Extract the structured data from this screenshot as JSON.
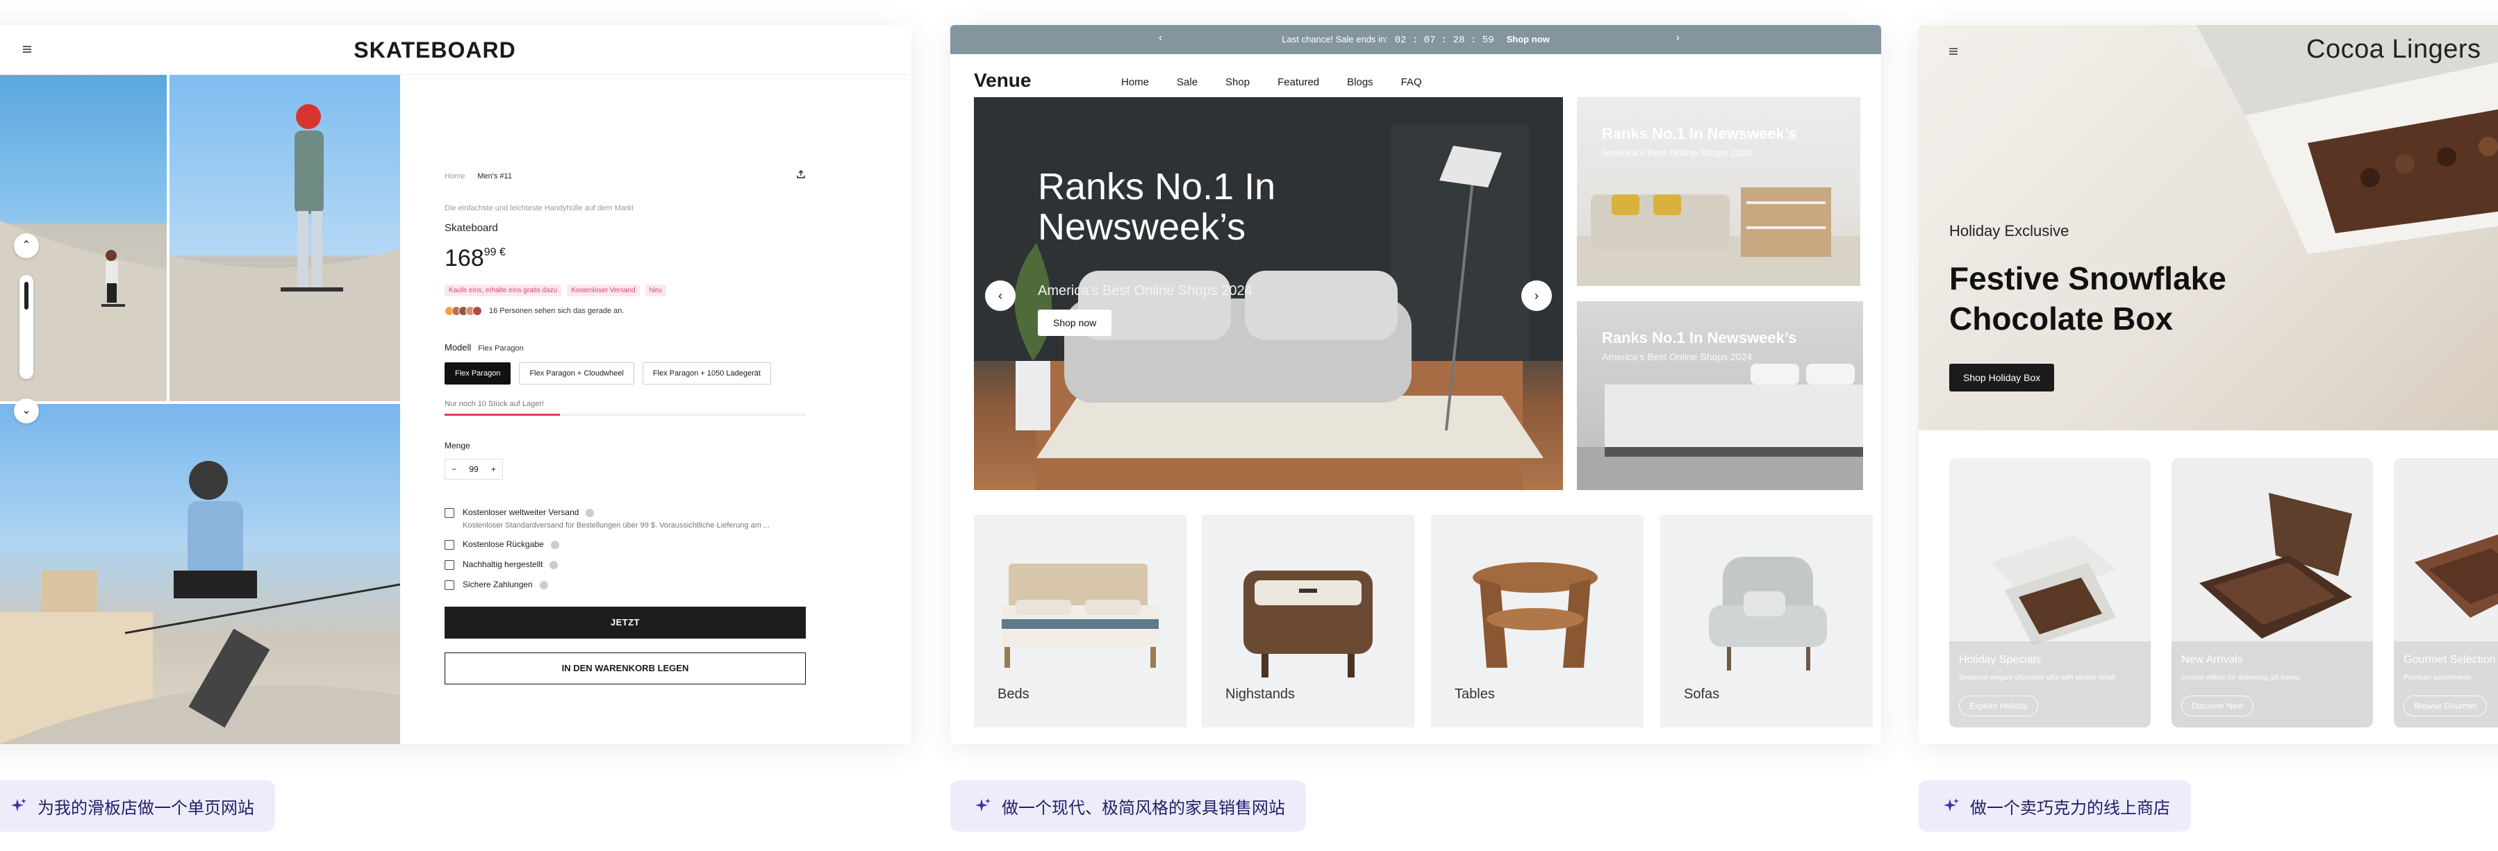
{
  "card1": {
    "brand": "SKATEBOARD",
    "breadcrumb": [
      "Home",
      "Men's #11"
    ],
    "tagline": "Die einfachste und leichteste Handyhülle auf dem Markt",
    "product_title": "Skateboard",
    "price_main": "168",
    "price_cents": "99 €",
    "badges": [
      "Kaufe eins, erhalte eins gratis dazu",
      "Kostenloser Versand",
      "Neu"
    ],
    "viewers_text": "16 Personen sehen sich das gerade an.",
    "model_label": "Modell",
    "model_value": "Flex Paragon",
    "options": [
      "Flex Paragon",
      "Flex Paragon + Cloudwheel",
      "Flex Paragon + 1050 Ladegerät"
    ],
    "stock_text": "Nur noch 10 Stück auf Lager!",
    "stock_fraction": 0.32,
    "quantity_label": "Menge",
    "quantity_value": "99",
    "stepper_minus": "−",
    "stepper_plus": "+",
    "features": [
      {
        "title": "Kostenloser weltweiter Versand",
        "sub": "Kostenloser Standardversand für Bestellungen über 99 $. Voraussichtliche Lieferung am ..."
      },
      {
        "title": "Kostenlose Rückgabe",
        "sub": ""
      },
      {
        "title": "Nachhaltig hergestellt",
        "sub": ""
      },
      {
        "title": "Sichere Zahlungen",
        "sub": ""
      }
    ],
    "buy_label": "JETZT",
    "cart_label": "IN DEN WARENKORB LEGEN",
    "icons": {
      "menu": "menu-icon",
      "search": "search-icon",
      "user": "user-icon",
      "bag": "bag-icon",
      "share": "share-icon"
    }
  },
  "card2": {
    "promo_text": "Last chance! Sale ends in:",
    "countdown": "02 : 07 : 28 : 59",
    "promo_link": "Shop now",
    "logo": "Venue",
    "nav": [
      "Home",
      "Sale",
      "Shop",
      "Featured",
      "Blogs",
      "FAQ"
    ],
    "hero_title": "Ranks No.1 In Newsweek’s",
    "hero_sub": "America’s Best Online Shops 2024",
    "hero_button": "Shop now",
    "side_title": "Ranks No.1 In Newsweek’s",
    "side_sub": "America’s Best Online Shops 2024",
    "categories": [
      "Beds",
      "Nighstands",
      "Tables",
      "Sofas"
    ],
    "colors": {
      "promo_bg": "#8495a0"
    }
  },
  "card3": {
    "brand": "Cocoa Lingers",
    "eyebrow": "Holiday Exclusive",
    "hero_title": "Festive Snowflake Chocolate Box",
    "hero_button": "Shop Holiday Box",
    "products": [
      {
        "title": "Holiday Specials",
        "desc": "Seasonal elegant chocolate gifts with serene detail",
        "button": "Explore Holiday"
      },
      {
        "title": "New Arrivals",
        "desc": "Limited edition for delivering gift boxes",
        "button": "Discover New"
      },
      {
        "title": "Gourmet Selection",
        "desc": "Premium assortments",
        "button": "Browse Gourmet"
      }
    ]
  },
  "prompts": [
    "为我的滑板店做一个单页网站",
    "做一个现代、极简风格的家具销售网站",
    "做一个卖巧克力的线上商店"
  ]
}
